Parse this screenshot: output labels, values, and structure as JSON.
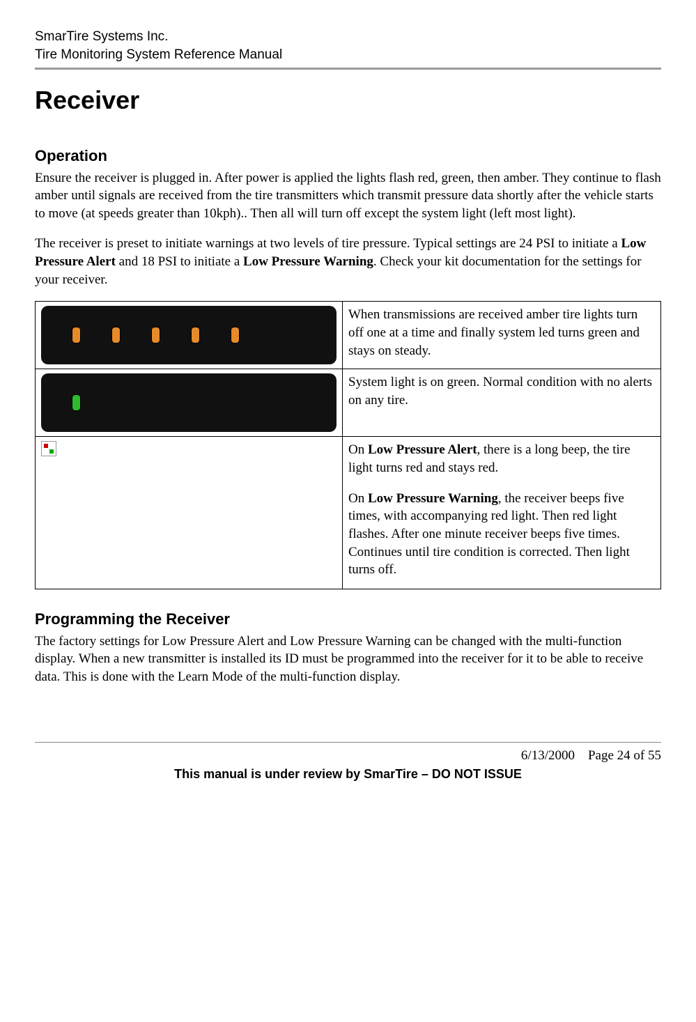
{
  "header": {
    "company": "SmarTire Systems Inc.",
    "manual": "Tire Monitoring System Reference Manual"
  },
  "h1": "Receiver",
  "section_operation": {
    "heading": "Operation",
    "p1": "Ensure the receiver is plugged in. After power is applied the lights flash red, green, then amber. They continue to flash amber until signals are received from the tire transmitters which transmit pressure data shortly after the vehicle starts to move (at speeds greater than 10kph).. Then all will turn off except the system light (left most light).",
    "p2_pre": "The receiver is preset to initiate warnings at two levels of tire pressure. Typical settings are 24 PSI to initiate a ",
    "p2_b1": "Low Pressure Alert",
    "p2_mid": " and 18 PSI to initiate a ",
    "p2_b2": "Low Pressure Warning",
    "p2_post": ". Check your kit documentation for the settings for your receiver."
  },
  "table": {
    "row1": "When transmissions are received amber tire lights turn off one at a time and finally system led turns green and stays on steady.",
    "row2": "System light is on green. Normal condition with no alerts on any tire.",
    "row3_pre": "On ",
    "row3_b1": "Low Pressure Alert",
    "row3_mid1": ", there is a long beep, the tire light turns red and stays red.",
    "row3_pre2": "On ",
    "row3_b2": "Low Pressure Warning",
    "row3_post": ", the receiver beeps five times, with accompanying red light. Then red light flashes. After one minute receiver beeps five times. Continues until tire condition is corrected. Then light turns off."
  },
  "section_programming": {
    "heading": "Programming the Receiver",
    "p1": "The factory settings for Low Pressure Alert and Low Pressure Warning can be changed with the multi-function display.  When a new transmitter is installed its ID must be programmed into the receiver for it to be able to receive data. This is done with the Learn Mode of the multi-function display."
  },
  "footer": {
    "date": "6/13/2000",
    "page": "Page 24 of 55",
    "review": "This manual is under review by SmarTire – DO NOT ISSUE"
  }
}
